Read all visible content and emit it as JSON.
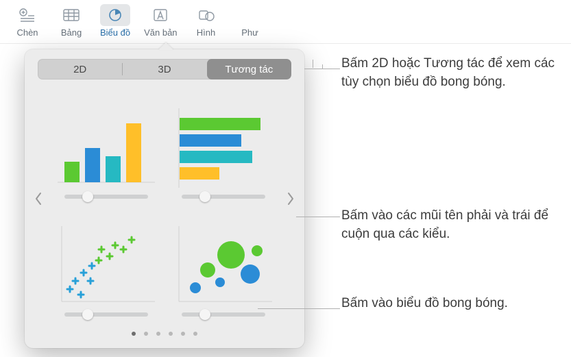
{
  "toolbar": {
    "insert": "Chèn",
    "table": "Bảng",
    "chart": "Biểu đồ",
    "text": "Văn bản",
    "shape": "Hình",
    "media": "Phư"
  },
  "tabs": {
    "d2": "2D",
    "d3": "3D",
    "interactive": "Tương tác"
  },
  "charts": {
    "column": "interactive-column-chart",
    "bar": "interactive-bar-chart",
    "scatter": "interactive-scatter-chart",
    "bubble": "interactive-bubble-chart"
  },
  "colors": {
    "green": "#5bc932",
    "blue": "#2b8cd6",
    "orange": "#ffbf29",
    "cyan": "#26b9c2"
  },
  "annotations": {
    "a1": "Bấm 2D hoặc Tương tác để xem các tùy chọn biểu đồ bong bóng.",
    "a2": "Bấm vào các mũi tên phải và trái để cuộn qua các kiểu.",
    "a3": "Bấm vào biểu đồ bong bóng."
  }
}
